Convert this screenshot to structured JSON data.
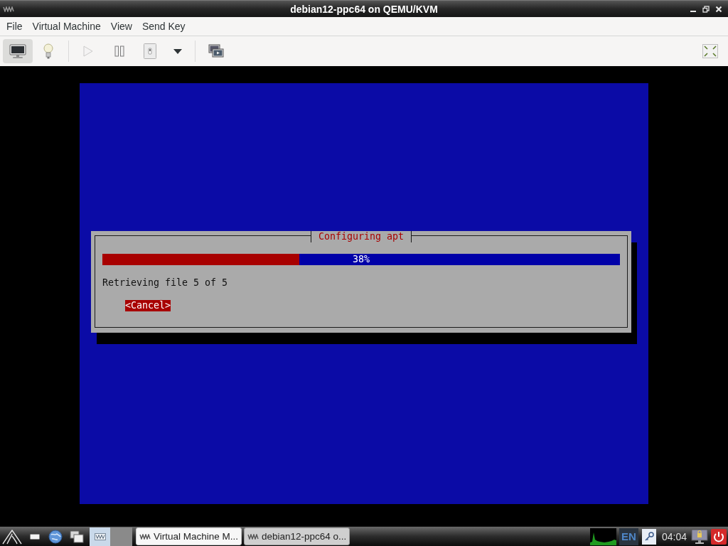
{
  "window": {
    "title": "debian12-ppc64 on QEMU/KVM"
  },
  "menu": [
    "File",
    "Virtual Machine",
    "View",
    "Send Key"
  ],
  "toolbar": {
    "console": {
      "selected": true
    },
    "details": {
      "selected": false
    },
    "run": {
      "disabled": true
    },
    "pause": {
      "disabled": false
    }
  },
  "console": {
    "dialog": {
      "title": "Configuring apt",
      "progress": {
        "level": 0.38,
        "reading": "38%"
      },
      "message": "Retrieving file 5 of 5",
      "button": "<Cancel>"
    }
  },
  "taskbar": {
    "tasks": [
      {
        "label": "Virtual Machine M...",
        "selected": false
      },
      {
        "label": "debian12-ppc64 o...",
        "selected": true
      }
    ],
    "keyboard_layout": "EN",
    "clock": "04:04"
  }
}
